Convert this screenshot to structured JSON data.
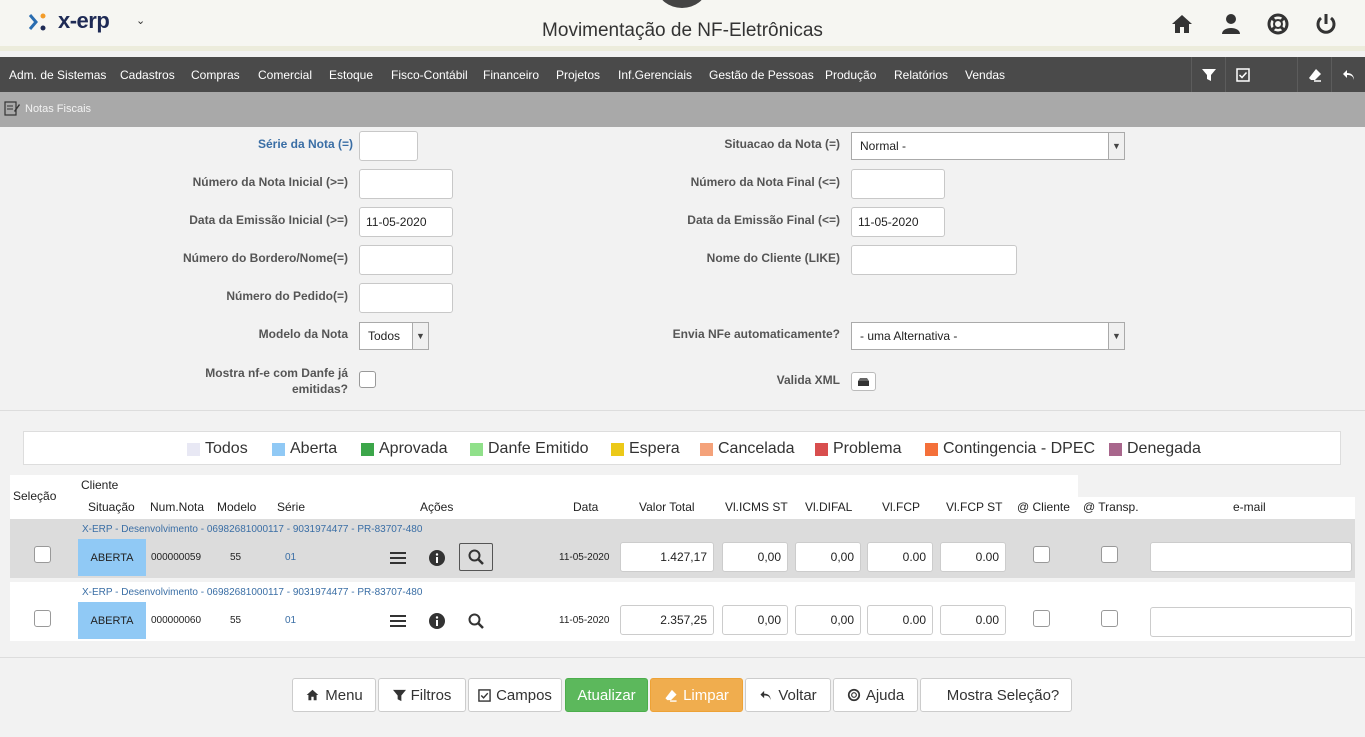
{
  "app": {
    "logo": "x-erp",
    "title": "Movimentação de NF-Eletrônicas"
  },
  "top_icons": [
    "home-icon",
    "user-icon",
    "support-icon",
    "power-icon"
  ],
  "menu": [
    "Adm. de Sistemas",
    "Cadastros",
    "Compras",
    "Comercial",
    "Estoque",
    "Fisco-Contábil",
    "Financeiro",
    "Projetos",
    "Inf.Gerenciais",
    "Gestão de Pessoas",
    "Produção",
    "Relatórios",
    "Vendas"
  ],
  "breadcrumb": "Notas Fiscais",
  "filters": {
    "serie_label": "Série da Nota (=)",
    "serie_value": "",
    "situacao_label": "Situacao da Nota (=)",
    "situacao_value": "Normal -",
    "num_ini_label": "Número da Nota Inicial (>=)",
    "num_ini_value": "",
    "num_fin_label": "Número da Nota Final (<=)",
    "num_fin_value": "",
    "data_ini_label": "Data da Emissão Inicial (>=)",
    "data_ini_value": "11-05-2020",
    "data_fin_label": "Data da Emissão Final (<=)",
    "data_fin_value": "11-05-2020",
    "bordero_label": "Número do Bordero/Nome(=)",
    "bordero_value": "",
    "cliente_label": "Nome do Cliente (LIKE)",
    "cliente_value": "",
    "pedido_label": "Número do Pedido(=)",
    "pedido_value": "",
    "modelo_label": "Modelo da Nota",
    "modelo_value": "Todos",
    "envia_label": "Envia NFe automaticamente?",
    "envia_value": "- uma Alternativa -",
    "danfe_label_1": "Mostra nf-e com Danfe já",
    "danfe_label_2": "emitidas?",
    "valida_label": "Valida XML"
  },
  "legend": [
    {
      "label": "Todos",
      "color": "#e8e8f4"
    },
    {
      "label": "Aberta",
      "color": "#90c9f5"
    },
    {
      "label": "Aprovada",
      "color": "#3ca64a"
    },
    {
      "label": "Danfe Emitido",
      "color": "#90e08a"
    },
    {
      "label": "Espera",
      "color": "#ecc918"
    },
    {
      "label": "Cancelada",
      "color": "#f4a27a"
    },
    {
      "label": "Problema",
      "color": "#d84e4e"
    },
    {
      "label": "Contingencia - DPEC",
      "color": "#f4703a"
    },
    {
      "label": "Denegada",
      "color": "#a8668c"
    }
  ],
  "grid": {
    "headers": {
      "selecao": "Seleção",
      "cliente": "Cliente",
      "situacao": "Situação",
      "num_nota": "Num.Nota",
      "modelo": "Modelo",
      "serie": "Série",
      "acoes": "Ações",
      "data": "Data",
      "valor_total": "Valor Total",
      "vl_icms_st": "Vl.ICMS ST",
      "vl_difal": "Vl.DIFAL",
      "vl_fcp": "Vl.FCP",
      "vl_fcp_st": "Vl.FCP ST",
      "at_cliente": "@ Cliente",
      "at_transp": "@ Transp.",
      "email": "e-mail"
    },
    "rows": [
      {
        "cliente": "X-ERP - Desenvolvimento - 06982681000117 - 9031974477 - PR-83707-480",
        "situacao": "ABERTA",
        "num_nota": "000000059",
        "modelo": "55",
        "serie": "01",
        "data": "11-05-2020",
        "valor_total": "1.427,17",
        "vl_icms_st": "0,00",
        "vl_difal": "0,00",
        "vl_fcp": "0.00",
        "vl_fcp_st": "0.00"
      },
      {
        "cliente": "X-ERP - Desenvolvimento - 06982681000117 - 9031974477 - PR-83707-480",
        "situacao": "ABERTA",
        "num_nota": "000000060",
        "modelo": "55",
        "serie": "01",
        "data": "11-05-2020",
        "valor_total": "2.357,25",
        "vl_icms_st": "0,00",
        "vl_difal": "0,00",
        "vl_fcp": "0.00",
        "vl_fcp_st": "0.00"
      }
    ]
  },
  "buttons": {
    "menu": "Menu",
    "filtros": "Filtros",
    "campos": "Campos",
    "atualizar": "Atualizar",
    "limpar": "Limpar",
    "voltar": "Voltar",
    "ajuda": "Ajuda",
    "mostra": "Mostra Seleção?"
  },
  "colors": {
    "menubar": "#4a4a4a",
    "status_aberta": "#90c9f5",
    "link": "#3a6ea5",
    "btn_green": "#5cb85c",
    "btn_orange": "#f0ad4e"
  }
}
